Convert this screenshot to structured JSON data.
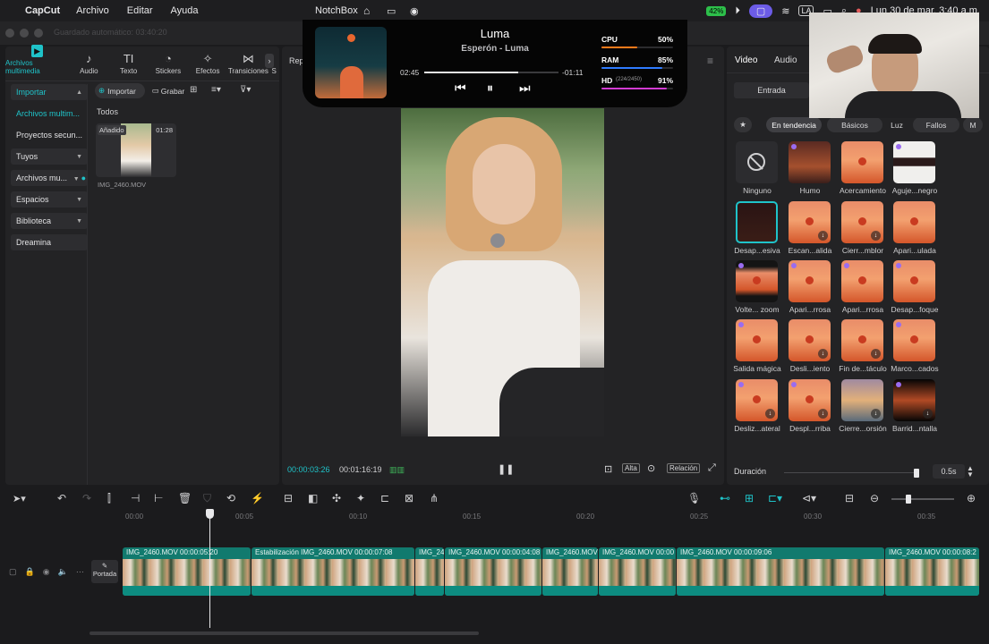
{
  "menubar": {
    "apple": "",
    "app_name": "CapCut",
    "items": [
      "Archivo",
      "Editar",
      "Ayuda"
    ],
    "center_app": "NotchBox",
    "battery": "42%",
    "input": "LA",
    "datetime": "Lun 30 de mar. 3:40 a.m."
  },
  "window_title": "Guardado automático: 03:40:20",
  "media_tabs": [
    {
      "label": "Archivos multimedia",
      "icon": "▶"
    },
    {
      "label": "Audio",
      "icon": "♪"
    },
    {
      "label": "Texto",
      "icon": "TI"
    },
    {
      "label": "Stickers",
      "icon": "◔"
    },
    {
      "label": "Efectos",
      "icon": "✧"
    },
    {
      "label": "Transiciones",
      "icon": "⋈"
    },
    {
      "label": "S",
      "icon": ""
    }
  ],
  "sidebar": [
    {
      "label": "Importar",
      "type": "head"
    },
    {
      "label": "Archivos multim...",
      "type": "hl"
    },
    {
      "label": "Proyectos secun...",
      "type": "plain"
    },
    {
      "label": "Tuyos",
      "type": "box"
    },
    {
      "label": "Archivos mu...",
      "type": "box"
    },
    {
      "label": "Espacios",
      "type": "box"
    },
    {
      "label": "Biblioteca",
      "type": "box"
    },
    {
      "label": "Dreamina",
      "type": "box"
    }
  ],
  "media": {
    "import_label": "Importar",
    "record_label": "Grabar",
    "section": "Todos",
    "item": {
      "badge": "Añadido",
      "duration": "01:28",
      "name": "IMG_2460.MOV"
    }
  },
  "preview": {
    "header": "Rep",
    "current": "00:00:03:26",
    "total": "00:01:16:19",
    "quality": "Alta",
    "ratio": "Relación"
  },
  "notchbox": {
    "track": "Luma",
    "artist": "Esperón - Luma",
    "elapsed": "02:45",
    "remaining": "-01:11",
    "progress": 0.7,
    "stats": [
      {
        "label": "CPU",
        "value": "50%",
        "fill": 0.5,
        "color": "#ff7a1a"
      },
      {
        "label": "RAM",
        "value": "85%",
        "fill": 0.85,
        "color": "#2e7bff"
      },
      {
        "label": "HD",
        "sub": "(224/2450)",
        "value": "91%",
        "fill": 0.91,
        "color": "#d33bd3"
      }
    ]
  },
  "right_panel": {
    "tabs": [
      "Video",
      "Audio"
    ],
    "subtab": "Entrada",
    "filters": [
      "En tendencia",
      "Básicos",
      "Luz",
      "Fallos",
      "M"
    ],
    "effects": [
      "Ninguno",
      "Humo",
      "Acercamiento",
      "Aguje...negro",
      "Desap...esiva",
      "Escan...alida",
      "Cierr...mblor",
      "Apari...ulada",
      "Volte... zoom",
      "Apari...rrosa",
      "Apari...rrosa",
      "Desap...foque",
      "Salida mágica",
      "Desli...iento",
      "Fin de...táculo",
      "Marco...cados",
      "Desliz...ateral",
      "Despl...rriba",
      "Cierre...orsión",
      "Barrid...ntalla"
    ],
    "duration_label": "Duración",
    "duration_value": "0.5s"
  },
  "timeline": {
    "ticks": [
      "00:00",
      "00:05",
      "00:10",
      "00:15",
      "00:20",
      "00:25",
      "00:30",
      "00:35"
    ],
    "cover_label": "Portada",
    "clips": [
      {
        "label": "IMG_2460.MOV  00:00:05:20"
      },
      {
        "label": "Estabilización  IMG_2460.MOV  00:00:07:08"
      },
      {
        "label": "IMG_24"
      },
      {
        "label": "IMG_2460.MOV  00:00:04:08"
      },
      {
        "label": "IMG_2460.MOV"
      },
      {
        "label": "IMG_2460.MOV  00:00"
      },
      {
        "label": "IMG_2460.MOV  00:00:09:06"
      },
      {
        "label": "IMG_2460.MOV  00:00:08:2"
      }
    ]
  }
}
